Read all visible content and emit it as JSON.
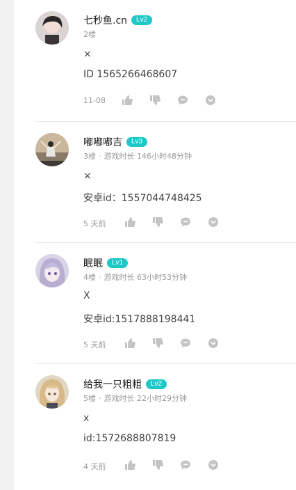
{
  "comments": [
    {
      "name": "七秒鱼.cn",
      "level": "Lv2",
      "floor": "2楼",
      "playtime": "",
      "line1": "×",
      "line2": "ID 1565266468607",
      "time": "11-08"
    },
    {
      "name": "嘟嘟嘟吉",
      "level": "Lv3",
      "floor": "3楼",
      "playtime": "游戏时长 146小时48分钟",
      "line1": "×",
      "line2": "安卓id：1557044748425",
      "time": "5 天前"
    },
    {
      "name": "眠眠",
      "level": "Lv1",
      "floor": "4楼",
      "playtime": "游戏时长 63小时53分钟",
      "line1": "X",
      "line2": "安卓id:1517888198441",
      "time": "5 天前"
    },
    {
      "name": "给我一只粗粗",
      "level": "Lv2",
      "floor": "5楼",
      "playtime": "游戏时长 22小时29分钟",
      "line1": "x",
      "line2": "id:1572688807819",
      "time": "4 天前"
    }
  ],
  "colors": {
    "badge": "#1ec8c8",
    "muted": "#999999",
    "icon": "#c4c4c4"
  },
  "icons": [
    "thumb-up-icon",
    "thumb-down-icon",
    "reply-bubble-icon",
    "more-chevron-icon"
  ]
}
